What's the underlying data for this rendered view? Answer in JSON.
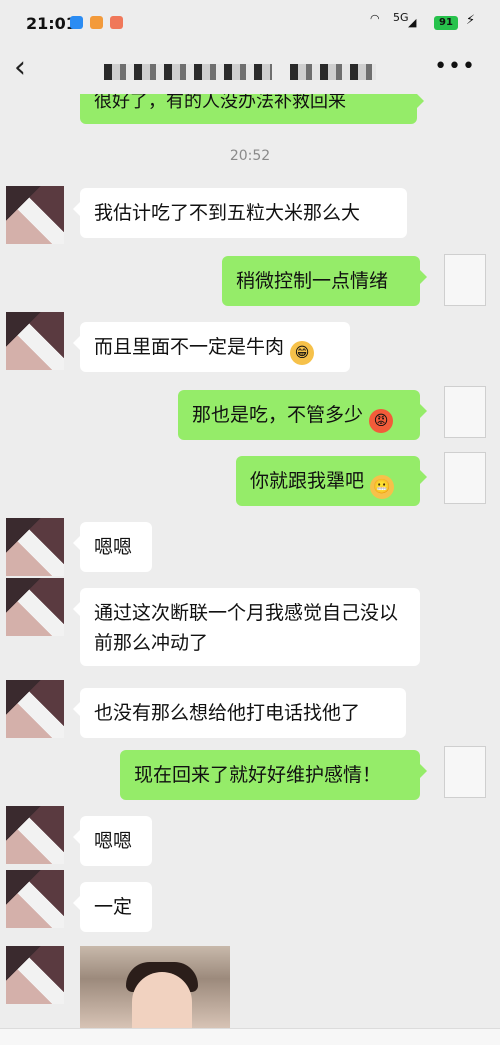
{
  "status": {
    "time": "21:01",
    "network": "5G",
    "battery": "91"
  },
  "nav": {
    "back_icon": "chevron-left-icon",
    "more_label": "•••"
  },
  "chat": {
    "top_partial": "很好了，有的人没办法补救回来",
    "timestamp": "20:52",
    "messages": [
      {
        "side": "in",
        "text": "我估计吃了不到五粒大米那么大"
      },
      {
        "side": "out",
        "text": "稍微控制一点情绪"
      },
      {
        "side": "in",
        "text": "而且里面不一定是牛肉",
        "emoji": "grin-emoji"
      },
      {
        "side": "out",
        "text": "那也是吃，不管多少",
        "emoji": "angry-emoji"
      },
      {
        "side": "out",
        "text": "你就跟我犟吧",
        "emoji": "grimace-emoji"
      },
      {
        "side": "in",
        "text": "嗯嗯"
      },
      {
        "side": "in",
        "text": "通过这次断联一个月我感觉自己没以前那么冲动了"
      },
      {
        "side": "in",
        "text": "也没有那么想给他打电话找他了"
      },
      {
        "side": "out",
        "text": "现在回来了就好好维护感情！"
      },
      {
        "side": "in",
        "text": "嗯嗯"
      },
      {
        "side": "in",
        "text": "一定"
      },
      {
        "side": "in",
        "type": "image",
        "image_icon": "photo-child-icon"
      }
    ]
  },
  "colors": {
    "background": "#ededed",
    "out_bubble": "#95ec69",
    "in_bubble": "#ffffff",
    "timestamp": "#8a8a8a"
  }
}
